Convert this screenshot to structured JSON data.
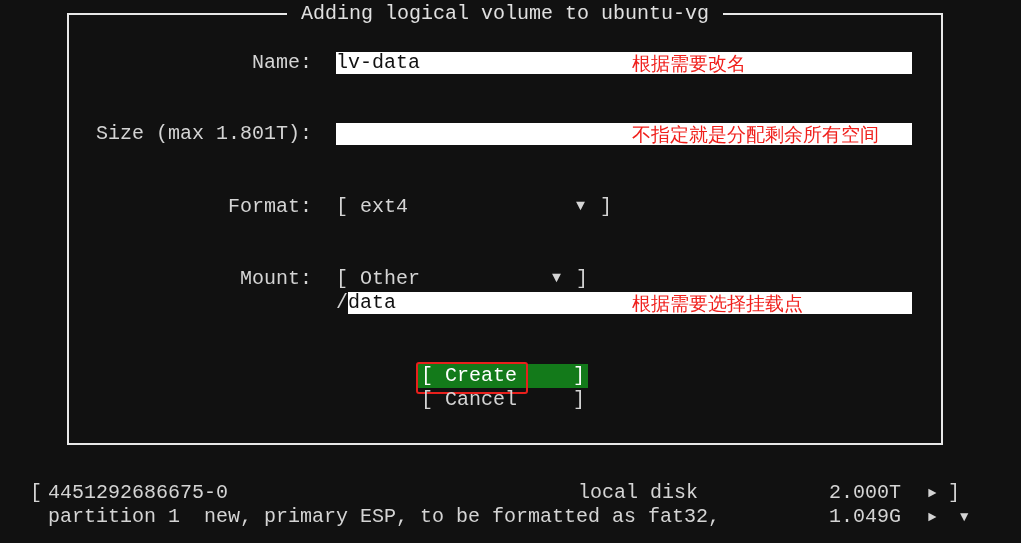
{
  "dialog": {
    "title": "Adding logical volume to ubuntu-vg",
    "fields": [
      {
        "kind": "text",
        "label": "Name:",
        "value": "lv-data",
        "note": "根据需要改名"
      },
      {
        "kind": "text",
        "label": "Size (max 1.801T):",
        "note": "不指定就是分配剩余所有空间"
      },
      {
        "kind": "select",
        "label": "Format:",
        "open": "[",
        "value": "ext4",
        "arrow": "▼",
        "close": "]"
      },
      {
        "kind": "select",
        "label": "Mount:",
        "open": "[",
        "value": "Other",
        "arrow": "▼",
        "close": "]"
      },
      {
        "kind": "path",
        "prefix": "/",
        "value": "data",
        "note": "根据需要选择挂载点"
      }
    ],
    "buttons": [
      {
        "open": "[",
        "label": "Create",
        "close": "]",
        "selected": true,
        "highlighted": true
      },
      {
        "open": "[",
        "label": "Cancel",
        "close": "]",
        "selected": false,
        "highlighted": false
      }
    ]
  },
  "disk_list": [
    {
      "kind": "disk",
      "open": "[",
      "name": "4451292686675-0",
      "type": "local disk",
      "size": "2.000T",
      "arrow": "►",
      "close": "]"
    },
    {
      "kind": "partition",
      "name": "partition 1",
      "description": "new, primary ESP, to be formatted as fat32,",
      "size": "1.049G",
      "arrow": "►",
      "scroll": "▼"
    }
  ]
}
